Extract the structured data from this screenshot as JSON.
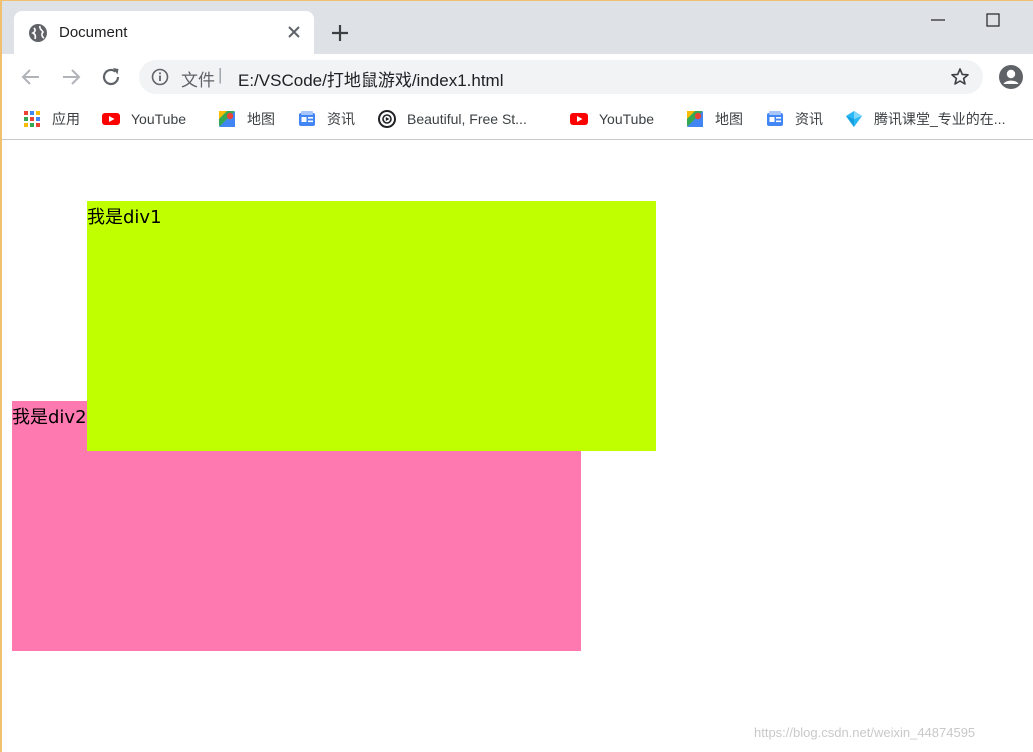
{
  "tab": {
    "title": "Document"
  },
  "omnibox": {
    "scheme_label": "文件",
    "separator": "|",
    "url": "E:/VSCode/打地鼠游戏/index1.html"
  },
  "bookmarks": [
    {
      "label": "应用",
      "icon": "apps-grid-icon"
    },
    {
      "label": "YouTube",
      "icon": "youtube-icon"
    },
    {
      "label": "地图",
      "icon": "maps-icon"
    },
    {
      "label": "资讯",
      "icon": "news-icon"
    },
    {
      "label": "Beautiful, Free St...",
      "icon": "unsplash-icon"
    },
    {
      "label": "YouTube",
      "icon": "youtube-icon"
    },
    {
      "label": "地图",
      "icon": "maps-icon"
    },
    {
      "label": "资讯",
      "icon": "news-icon"
    },
    {
      "label": "腾讯课堂_专业的在...",
      "icon": "tencent-classroom-icon"
    }
  ],
  "page": {
    "div1_text": "我是div1",
    "div2_text": "我是div2",
    "div1_color": "#bfff00",
    "div2_color": "#ff79b1"
  },
  "watermark": "https://blog.csdn.net/weixin_44874595"
}
